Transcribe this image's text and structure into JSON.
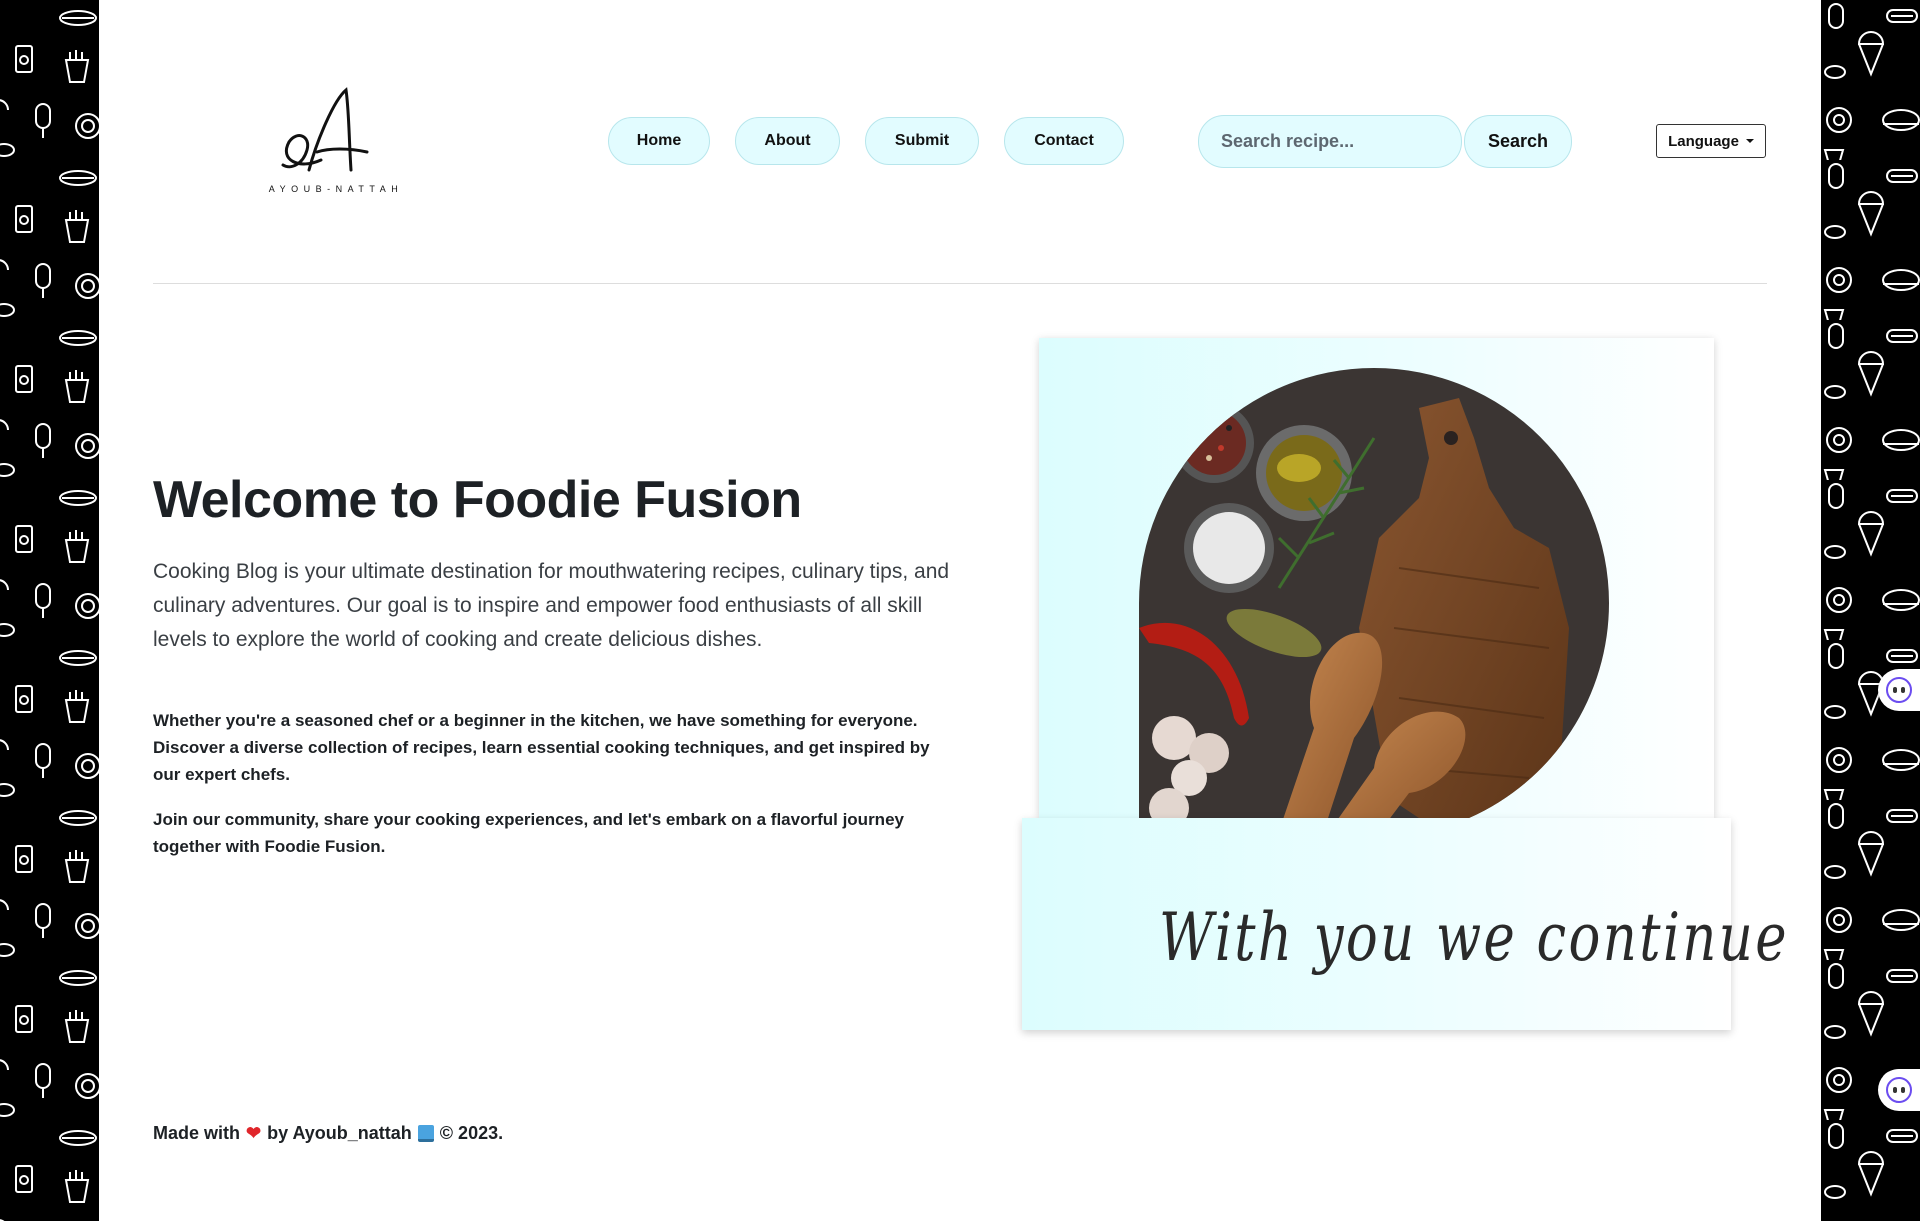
{
  "header": {
    "logo_text": "AYOUB-NATTAH",
    "nav": [
      {
        "label": "Home"
      },
      {
        "label": "About"
      },
      {
        "label": "Submit"
      },
      {
        "label": "Contact"
      }
    ],
    "search": {
      "placeholder": "Search recipe...",
      "value": "",
      "button_label": "Search"
    },
    "language_label": "Language"
  },
  "hero": {
    "title": "Welcome to Foodie Fusion",
    "lead": "Cooking Blog is your ultimate destination for mouthwatering recipes, culinary tips, and culinary adventures. Our goal is to inspire and empower food enthusiasts of all skill levels to explore the world of cooking and create delicious dishes.",
    "paragraph1": "Whether you're a seasoned chef or a beginner in the kitchen, we have something for everyone. Discover a diverse collection of recipes, learn essential cooking techniques, and get inspired by our expert chefs.",
    "paragraph2": "Join our community, share your cooking experiences, and let's embark on a flavorful journey together with Foodie Fusion.",
    "image_caption": "With you we continue"
  },
  "footer": {
    "made_with": "Made with",
    "by": "by Ayoub_nattah",
    "copyright": "© 2023."
  },
  "colors": {
    "pill_bg": "#e2fcff",
    "pill_border": "#b7e6ec",
    "side_bg": "#000000",
    "heart": "#e0262b"
  },
  "icons": [
    "food-pattern-icon",
    "heart-icon",
    "book-icon",
    "chatbot-icon",
    "caret-down-icon"
  ]
}
